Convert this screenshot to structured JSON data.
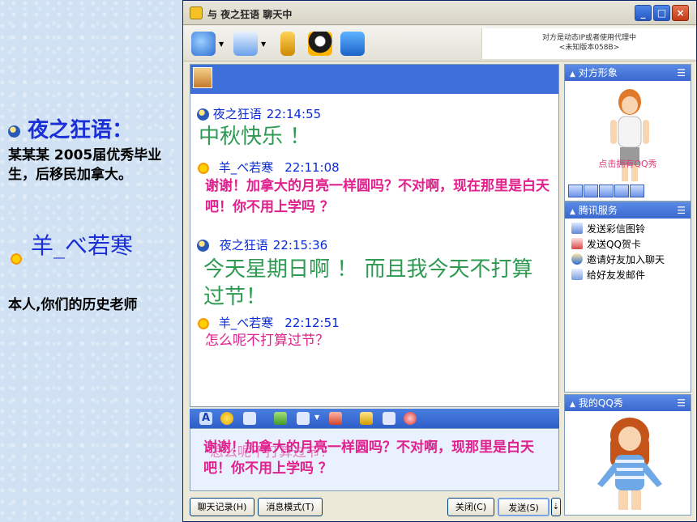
{
  "slide": {
    "name1": "夜之狂语：",
    "desc1": "某某某 2005届优秀毕业生，后移民加拿大。",
    "name2": "羊_べ若寒",
    "desc2": "本人,你们的历史老师"
  },
  "window": {
    "title": "与 夜之狂语 聊天中",
    "status_note_line1": "对方是动态IP或者使用代理中",
    "status_note_line2": "<未知版本058B>"
  },
  "messages": [
    {
      "sender": "夜之狂语",
      "time": "22:14:55",
      "text": "中秋快乐 ！"
    },
    {
      "sender": "羊_べ若寒",
      "time": "22:11:08",
      "text": "谢谢！加拿大的月亮一样圆吗？不对啊，现在那里是白天吧！你不用上学吗 ？"
    },
    {
      "sender": "夜之狂语",
      "time": "22:15:36",
      "text": "今天星期日啊 ！ 而且我今天不打算过节！"
    },
    {
      "sender": "羊_べ若寒",
      "time": "22:12:51",
      "text": "怎么呢不打算过节？"
    }
  ],
  "input": {
    "text": "谢谢！加拿大的月亮一样圆吗？不对啊，现那里是白天吧！你不用上学吗 ？",
    "ghost": "怎么呢不打算过节？"
  },
  "buttons": {
    "history": "聊天记录(H)",
    "mode": "消息模式(T)",
    "close": "关闭(C)",
    "send": "发送(S)"
  },
  "right_panel": {
    "peer_image_title": "对方形象",
    "show_caption": "点击拥有QQ秀",
    "services_title": "腾讯服务",
    "services": [
      "发送彩信图铃",
      "发送QQ贺卡",
      "邀请好友加入聊天",
      "给好友发邮件"
    ],
    "my_show_title": "我的QQ秀"
  },
  "colors": {
    "title_blue": "#1a2fd6",
    "green_msg": "#2e9a52",
    "pink_msg": "#e0208c"
  }
}
